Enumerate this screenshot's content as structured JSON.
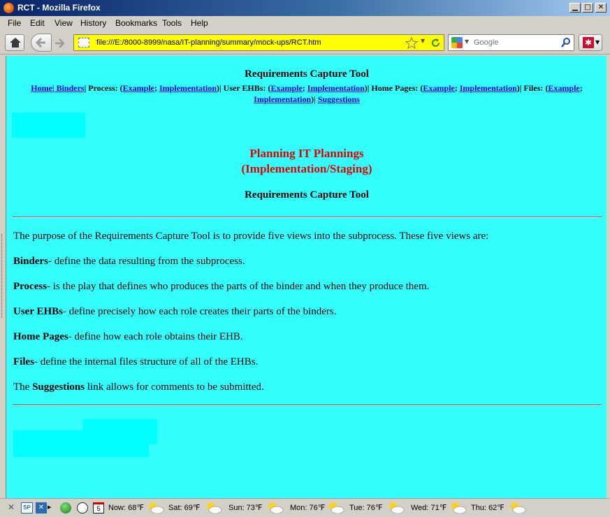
{
  "window": {
    "title": "RCT - Mozilla Firefox"
  },
  "menu": [
    "File",
    "Edit",
    "View",
    "History",
    "Bookmarks",
    "Tools",
    "Help"
  ],
  "toolbar": {
    "url": "file:///E:/8000-8999/nasa/IT-planning/summary/mock-ups/RCT.htm",
    "search_placeholder": "Google"
  },
  "page": {
    "site_title": "Requirements Capture Tool",
    "nav": {
      "home": "Home",
      "binders": " Binders",
      "process_label": "Process: (",
      "process_example": "Example",
      "process_impl": "Implementation",
      "user_ehbs_label": "User EHBs: (",
      "user_ehbs_example": "Example",
      "user_ehbs_impl": "Implementation",
      "home_pages_label": "Home Pages: (",
      "home_pages_example": "Example",
      "home_pages_impl": "Implementation",
      "files_label": "Files: (",
      "files_example": "Example",
      "files_impl": "Implementation",
      "suggestions": "Suggestions"
    },
    "heading_line1": "Planning IT Plannings",
    "heading_line2": "(Implementation/Staging)",
    "subheading": "Requirements Capture Tool",
    "intro": "The purpose of the Requirements Capture Tool is to provide five views into the subprocess. These five views are:",
    "views": [
      {
        "term": "Binders",
        "desc": "- define the data resulting from the subprocess."
      },
      {
        "term": "Process",
        "desc": "- is the play that defines who produces the parts of the binder and when they produce them."
      },
      {
        "term": "User EHBs",
        "desc": "- define precisely how each role creates their parts of the binders."
      },
      {
        "term": "Home Pages",
        "desc": "- define how each role obtains their EHB."
      },
      {
        "term": "Files",
        "desc": "- define the internal files structure of all of the EHBs."
      }
    ],
    "suggestions_prefix": "The ",
    "suggestions_term": "Suggestions",
    "suggestions_suffix": " link allows for comments to be submitted."
  },
  "statusbar": {
    "weather": [
      {
        "label": "Now: 68℉"
      },
      {
        "label": "Sat: 69℉"
      },
      {
        "label": "Sun: 73℉"
      },
      {
        "label": "Mon: 76℉"
      },
      {
        "label": "Tue: 76℉"
      },
      {
        "label": "Wed: 71℉"
      },
      {
        "label": "Thu: 62℉"
      }
    ],
    "sp_label": "SP",
    "calendar_day": "5"
  },
  "colors": {
    "page_bg": "#33ffff",
    "urlbar_bg": "#ffff00",
    "heading_red": "#e00000",
    "link_blue": "#0000ee"
  }
}
